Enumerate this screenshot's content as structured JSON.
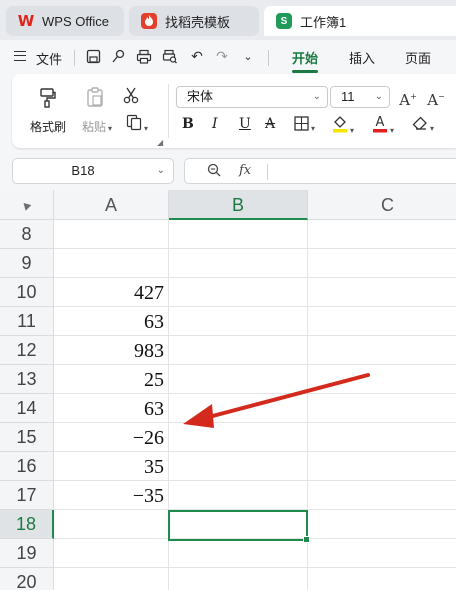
{
  "tabs": [
    {
      "label": "WPS Office",
      "icon": "wps-logo-icon"
    },
    {
      "label": "找稻壳模板",
      "icon": "docer-logo-icon"
    },
    {
      "label": "工作簿1",
      "icon": "spreadsheet-logo-icon"
    }
  ],
  "menu": {
    "file_label": "文件",
    "tabs": [
      "开始",
      "插入",
      "页面"
    ],
    "active_tab": "开始"
  },
  "ribbon": {
    "format_painter": "格式刷",
    "paste": "粘贴",
    "font_name": "宋体",
    "font_size": "11",
    "bold": "B",
    "italic": "I",
    "underline": "U",
    "strike": "A",
    "font_color": "#e02020",
    "highlight_color": "#f2e600"
  },
  "formula_bar": {
    "name_box": "B18",
    "fx_label": "fx",
    "formula": ""
  },
  "sheet": {
    "columns": [
      "A",
      "B",
      "C"
    ],
    "selected_column": "B",
    "rows": [
      {
        "num": "8",
        "a": ""
      },
      {
        "num": "9",
        "a": ""
      },
      {
        "num": "10",
        "a": "427"
      },
      {
        "num": "11",
        "a": "63"
      },
      {
        "num": "12",
        "a": "983"
      },
      {
        "num": "13",
        "a": "25"
      },
      {
        "num": "14",
        "a": "63"
      },
      {
        "num": "15",
        "a": "−26"
      },
      {
        "num": "16",
        "a": "35"
      },
      {
        "num": "17",
        "a": "−35"
      },
      {
        "num": "18",
        "a": ""
      },
      {
        "num": "19",
        "a": ""
      },
      {
        "num": "20",
        "a": ""
      }
    ],
    "selected_row": "18",
    "selected_cell": "B18"
  },
  "annotation": {
    "color": "#d42a1e"
  }
}
